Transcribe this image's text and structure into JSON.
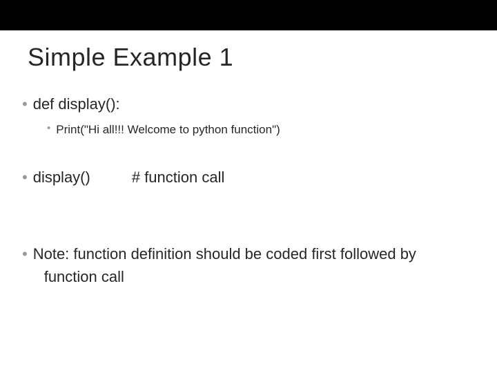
{
  "title": "Simple Example 1",
  "items": {
    "def_line": "def display():",
    "print_line": "Print(\"Hi all!!! Welcome to python function\")",
    "call_left": "display()",
    "call_right": "# function call",
    "note_line1": "Note: function definition should be coded first followed by",
    "note_line2": "function call"
  }
}
